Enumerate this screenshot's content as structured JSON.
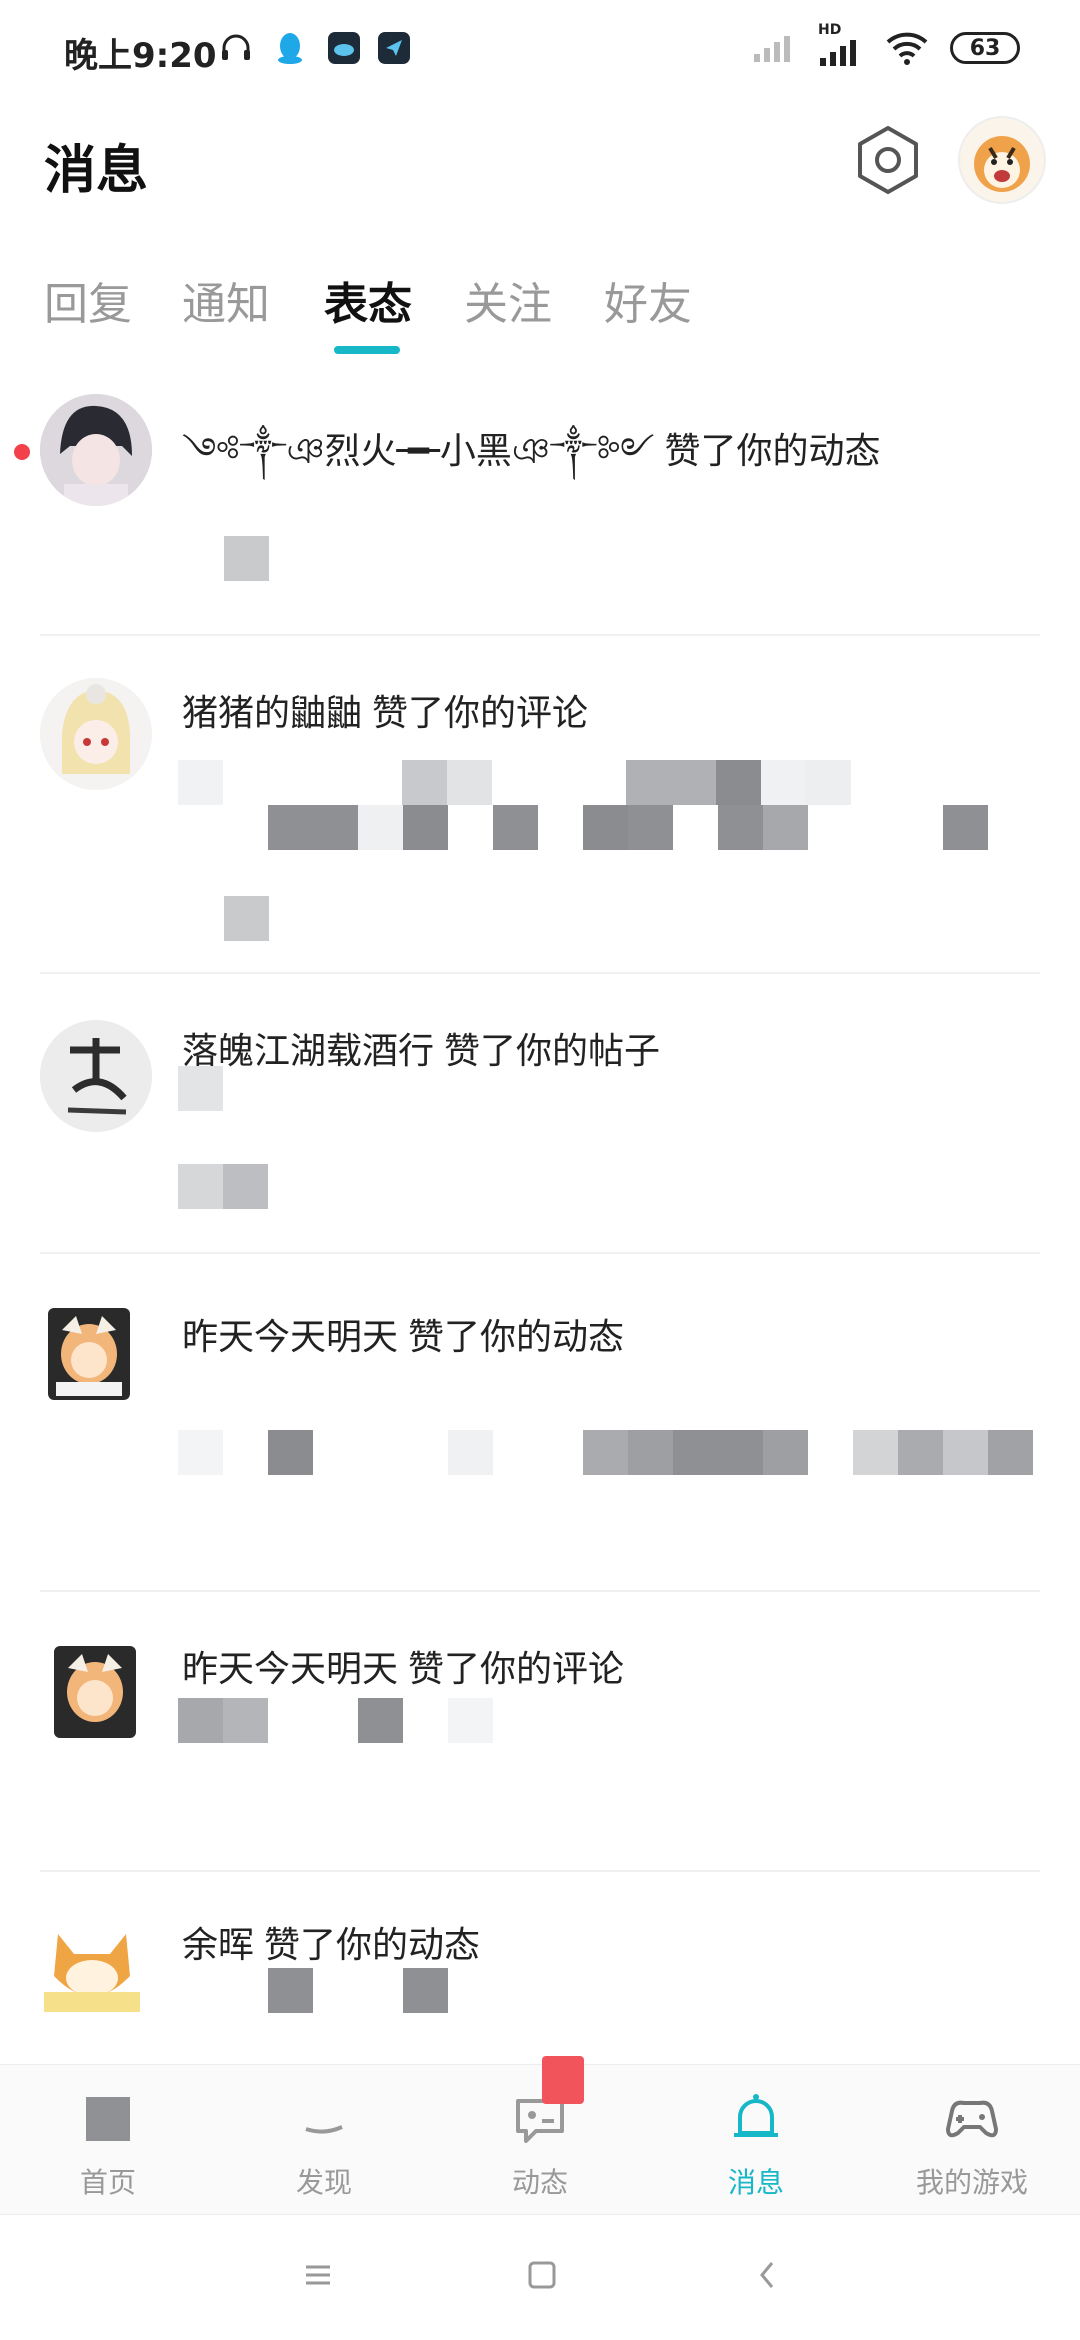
{
  "status_bar": {
    "time": "晚上9:20",
    "battery": "63",
    "network": "HD"
  },
  "header": {
    "title": "消息"
  },
  "tabs": [
    {
      "label": "回复"
    },
    {
      "label": "通知"
    },
    {
      "label": "表态"
    },
    {
      "label": "关注"
    },
    {
      "label": "好友"
    }
  ],
  "active_tab": "表态",
  "messages": [
    {
      "actor": "༺༒ঞ烈火╼╾小黑ঞ༒༻",
      "action": "赞了你的动态",
      "unread": true
    },
    {
      "actor": "猪猪的鼬鼬",
      "action": "赞了你的评论",
      "unread": false
    },
    {
      "actor": "落魄江湖载酒行",
      "action": "赞了你的帖子",
      "unread": false
    },
    {
      "actor": "昨天今天明天",
      "action": "赞了你的动态",
      "unread": false
    },
    {
      "actor": "昨天今天明天",
      "action": "赞了你的评论",
      "unread": false
    },
    {
      "actor": "余晖",
      "action": "赞了你的动态",
      "unread": false
    }
  ],
  "bottom_nav": [
    {
      "label": "首页",
      "icon": "home-icon"
    },
    {
      "label": "发现",
      "icon": "discover-icon"
    },
    {
      "label": "动态",
      "icon": "feed-icon"
    },
    {
      "label": "消息",
      "icon": "bell-icon"
    },
    {
      "label": "我的游戏",
      "icon": "gamepad-icon"
    }
  ],
  "colors": {
    "accent": "#16b7c6",
    "unread_dot": "#f2414b",
    "badge": "#f2545b"
  }
}
